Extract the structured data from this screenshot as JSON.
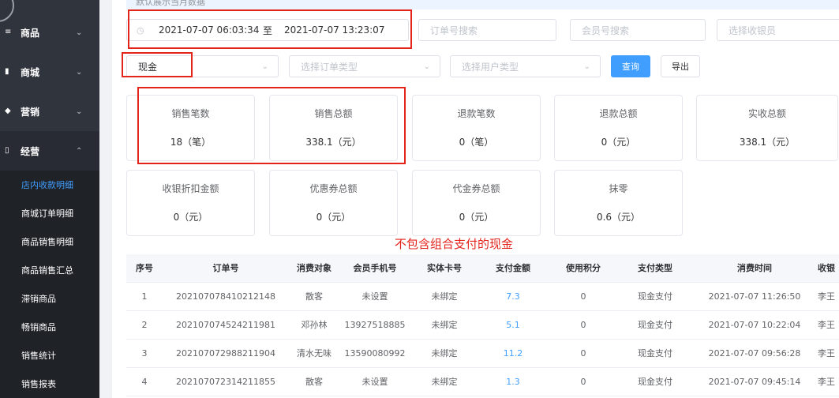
{
  "notice_text": "默认展示当月数据",
  "sidebar": {
    "groups": [
      {
        "label": "商品",
        "arrow": "⌄"
      },
      {
        "label": "商城",
        "arrow": "⌄"
      },
      {
        "label": "营销",
        "arrow": "⌄"
      },
      {
        "label": "经营",
        "arrow": "⌃"
      }
    ],
    "sub_items": [
      {
        "label": "店内收款明细"
      },
      {
        "label": "商城订单明细"
      },
      {
        "label": "商品销售明细"
      },
      {
        "label": "商品销售汇总"
      },
      {
        "label": "滞销商品"
      },
      {
        "label": "畅销商品"
      },
      {
        "label": "销售统计"
      },
      {
        "label": "销售报表"
      }
    ]
  },
  "filters": {
    "date_start": "2021-07-07 06:03:34",
    "date_sep": "至",
    "date_end": "2021-07-07 13:23:07",
    "order_search_placeholder": "订单号搜索",
    "member_search_placeholder": "会员号搜索",
    "cashier_placeholder": "选择收银员",
    "payment_value": "现金",
    "order_type_placeholder": "选择订单类型",
    "user_type_placeholder": "选择用户类型",
    "query_label": "查询",
    "export_label": "导出"
  },
  "stats": [
    {
      "label": "销售笔数",
      "value": "18（笔）"
    },
    {
      "label": "销售总额",
      "value": "338.1（元）"
    },
    {
      "label": "退款笔数",
      "value": "0（笔）"
    },
    {
      "label": "退款总额",
      "value": "0（元）"
    },
    {
      "label": "实收总额",
      "value": "338.1（元）"
    },
    {
      "label": "收银折扣金额",
      "value": "0（元）"
    },
    {
      "label": "优惠券总额",
      "value": "0（元）"
    },
    {
      "label": "代金券总额",
      "value": "0（元）"
    },
    {
      "label": "抹零",
      "value": "0.6（元）"
    }
  ],
  "annotation_note": "不包含组合支付的现金",
  "table": {
    "headers": [
      "序号",
      "订单号",
      "消费对象",
      "会员手机号",
      "实体卡号",
      "支付金额",
      "使用积分",
      "支付类型",
      "消费时间",
      "收银"
    ],
    "rows": [
      [
        "1",
        "202107078410212148",
        "散客",
        "未设置",
        "未绑定",
        "7.3",
        "0",
        "现金支付",
        "2021-07-07 11:26:50",
        "李王"
      ],
      [
        "2",
        "202107074524211981",
        "邓孙林",
        "13927518885",
        "未绑定",
        "5.1",
        "0",
        "现金支付",
        "2021-07-07 10:22:04",
        "李王"
      ],
      [
        "3",
        "202107072988211904",
        "清水无味",
        "13590080992",
        "未绑定",
        "11.2",
        "0",
        "现金支付",
        "2021-07-07 09:56:28",
        "李王"
      ],
      [
        "4",
        "202107072314211855",
        "散客",
        "未设置",
        "未绑定",
        "1.3",
        "0",
        "现金支付",
        "2021-07-07 09:45:14",
        "李王"
      ]
    ]
  }
}
